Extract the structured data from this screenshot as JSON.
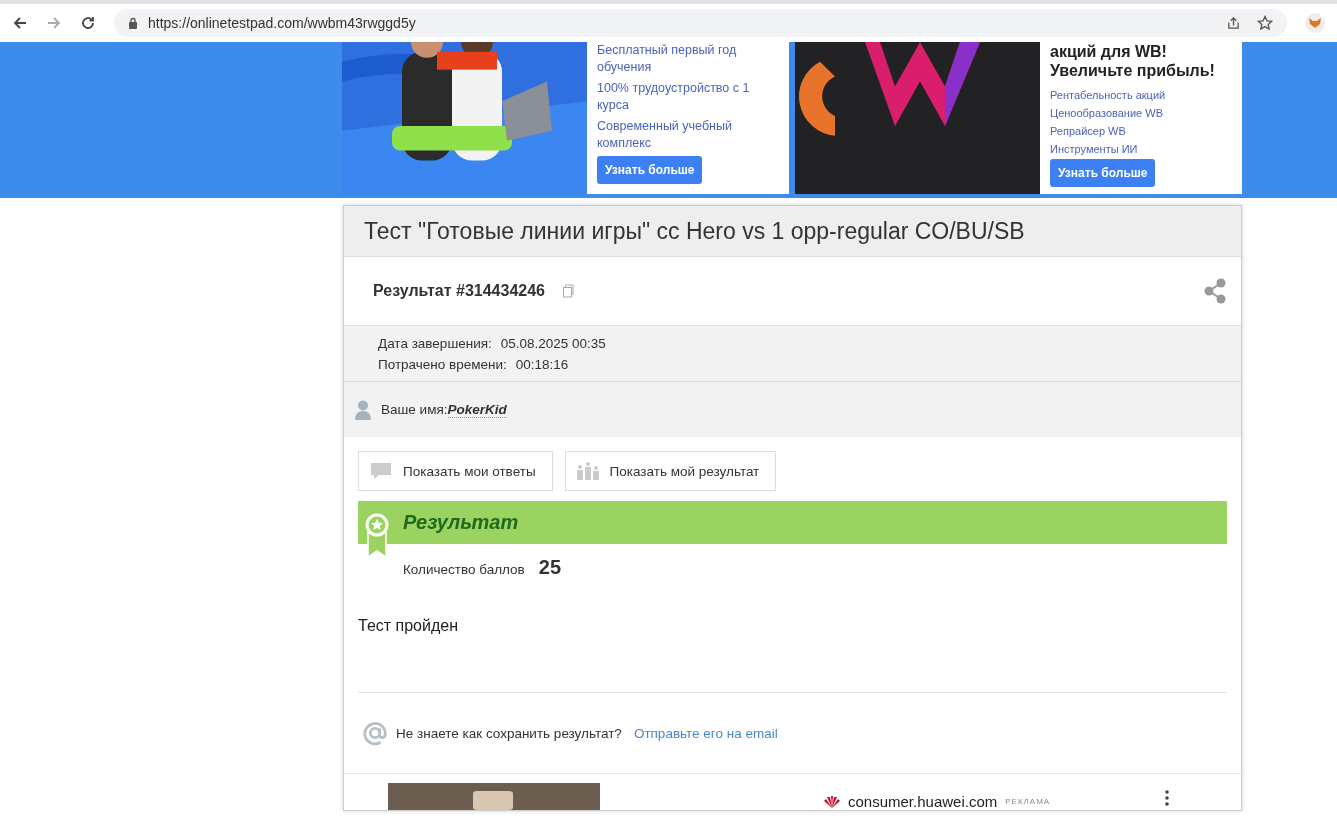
{
  "browser": {
    "url": "https://onlinetestpad.com/wwbm43rwggd5y"
  },
  "ads": [
    {
      "kind": "study",
      "items": [
        "Бесплатный первый год обучения",
        "100% трудоустройство с 1 курса",
        "Современный учебный комплекс"
      ],
      "button": "Узнать больше"
    },
    {
      "kind": "logo",
      "headline": "акций для WB! Увеличьте прибыль!",
      "items": [
        "Рентабельность акций",
        "Ценообразование WB",
        "Репрайсер WB",
        "Инструменты ИИ"
      ],
      "button": "Узнать больше"
    }
  ],
  "test": {
    "title": "Тест \"Готовые линии игры\" cc Hero vs 1 opp-regular CO/BU/SB",
    "result_label": "Результат #314434246",
    "details": [
      {
        "label": "Дата завершения:",
        "value": "05.08.2025 00:35"
      },
      {
        "label": "Потрачено времени:",
        "value": "00:18:16"
      }
    ],
    "name_label": "Ваше имя:",
    "name_value": "PokerKid",
    "buttons": [
      {
        "kind": "answers",
        "label": "Показать мои ответы"
      },
      {
        "kind": "result",
        "label": "Показать мой результат"
      }
    ],
    "result_heading": "Результат",
    "score_label": "Количество баллов",
    "score_value": "25",
    "status": "Тест пройден",
    "save_prompt": "Не знаете как сохранить результат?",
    "save_link": "Отправьте его на email"
  },
  "bottom_ad": {
    "domain": "consumer.huawei.com",
    "tag": "РЕКЛАМА"
  }
}
